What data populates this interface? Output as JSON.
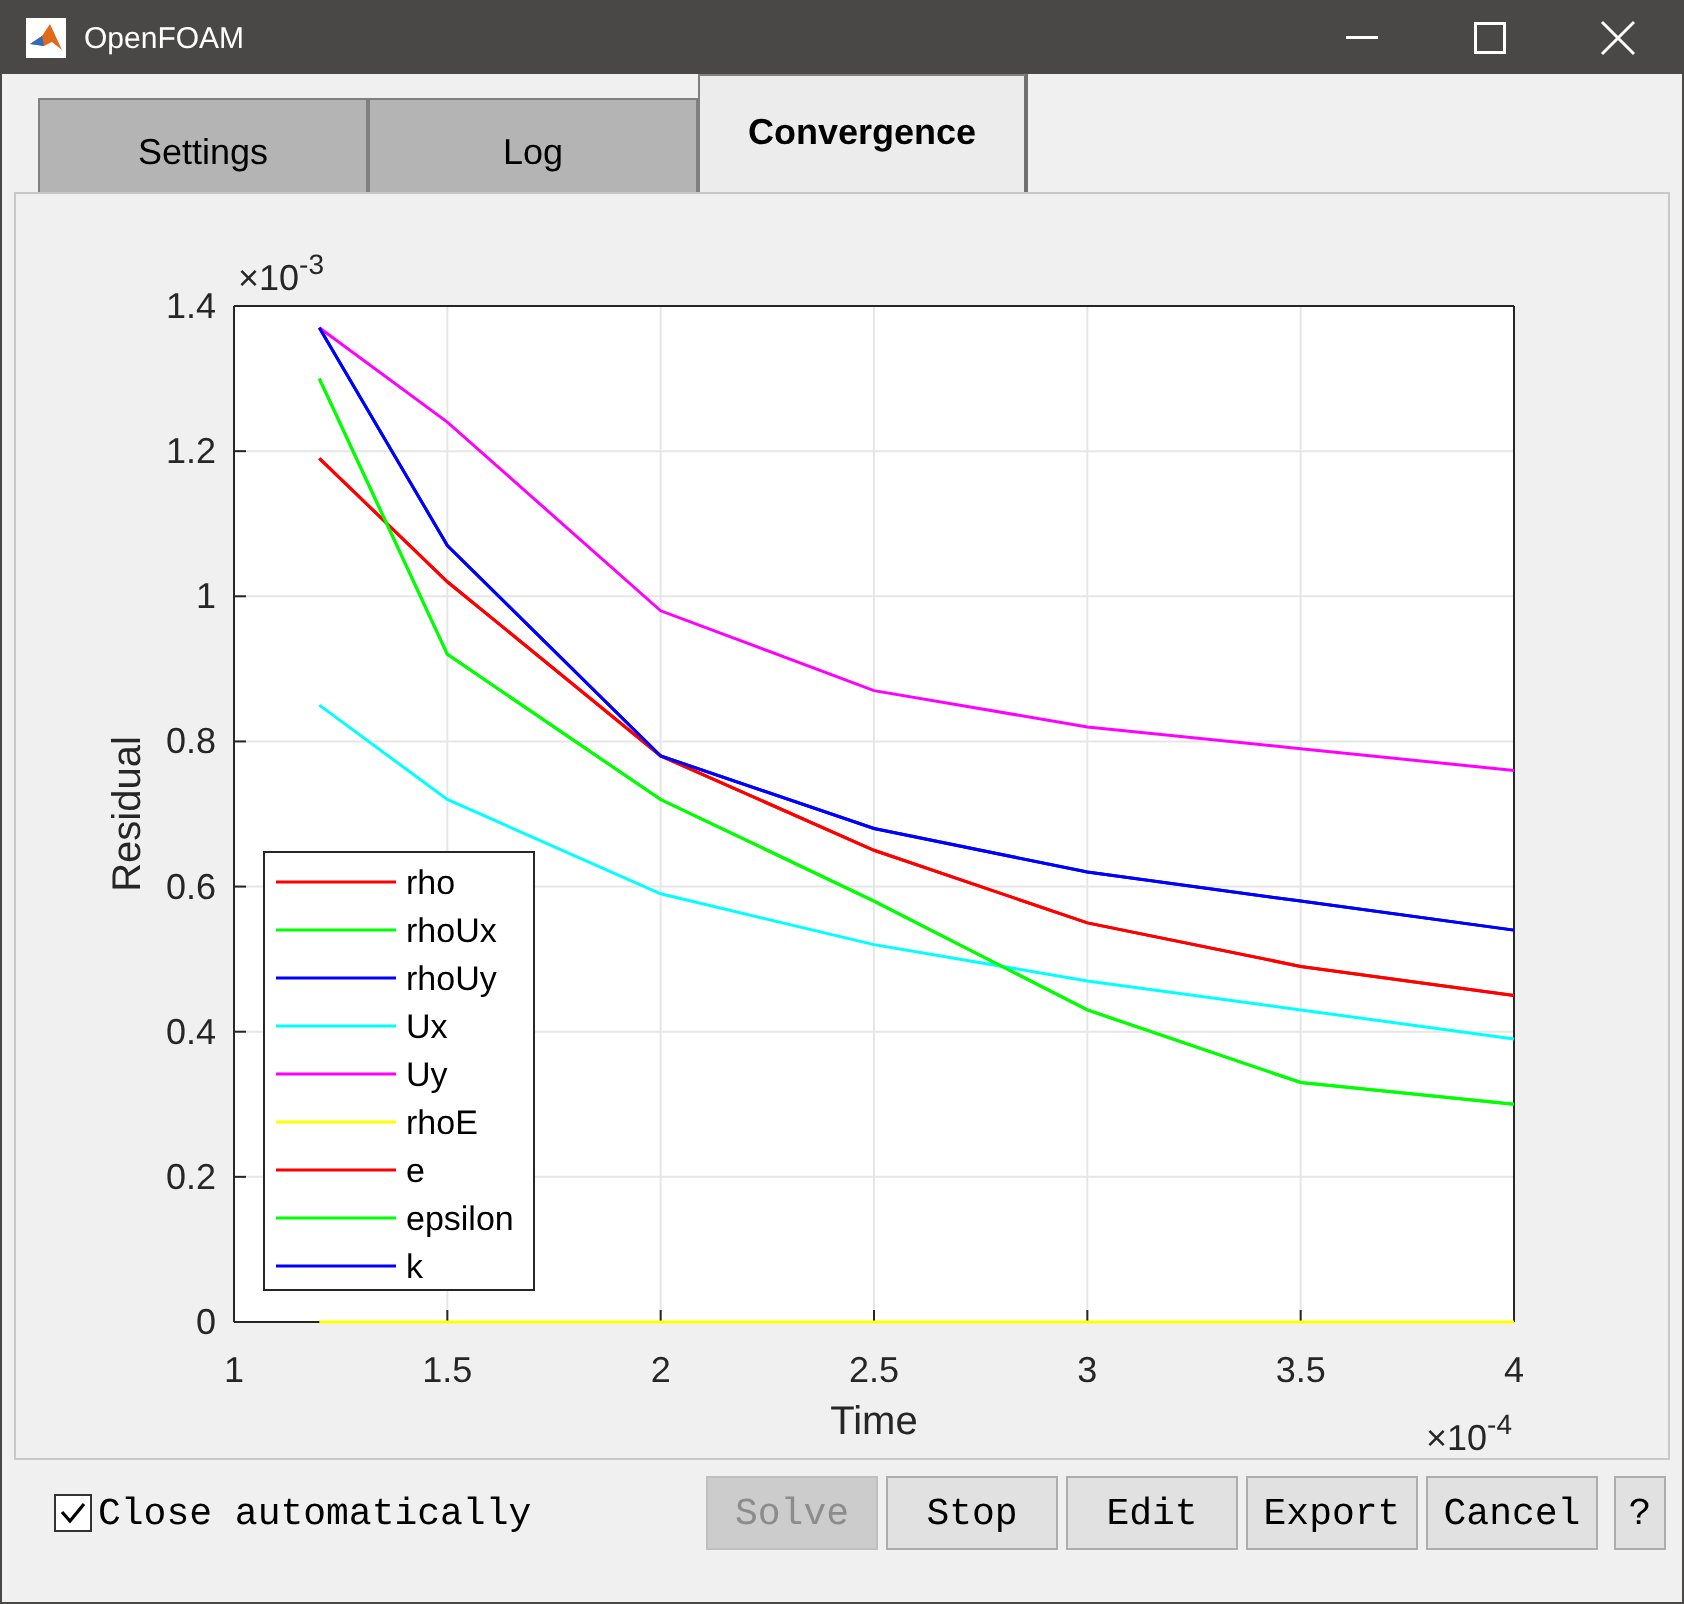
{
  "window": {
    "title": "OpenFOAM"
  },
  "tabs": [
    {
      "label": "Settings",
      "selected": false
    },
    {
      "label": "Log",
      "selected": false
    },
    {
      "label": "Convergence",
      "selected": true
    }
  ],
  "plot": {
    "y_multiplier": {
      "base": "×10",
      "exponent": "-3"
    },
    "x_multiplier": {
      "base": "×10",
      "exponent": "-4"
    },
    "chart_data": {
      "type": "line",
      "grid": true,
      "legend": true,
      "xlabel": "Time",
      "ylabel": "Residual",
      "x": [
        1.2,
        1.5,
        2,
        2.5,
        3,
        3.5,
        4
      ],
      "xlim": [
        1,
        4
      ],
      "ylim": [
        0,
        1.4
      ],
      "xticks": [
        {
          "value": 1,
          "label": "1"
        },
        {
          "value": 1.5,
          "label": "1.5"
        },
        {
          "value": 2,
          "label": "2"
        },
        {
          "value": 2.5,
          "label": "2.5"
        },
        {
          "value": 3,
          "label": "3"
        },
        {
          "value": 3.5,
          "label": "3.5"
        },
        {
          "value": 4,
          "label": "4"
        }
      ],
      "yticks": [
        {
          "value": 0,
          "label": "0"
        },
        {
          "value": 0.2,
          "label": "0.2"
        },
        {
          "value": 0.4,
          "label": "0.4"
        },
        {
          "value": 0.6,
          "label": "0.6"
        },
        {
          "value": 0.8,
          "label": "0.8"
        },
        {
          "value": 1,
          "label": "1"
        },
        {
          "value": 1.2,
          "label": "1.2"
        },
        {
          "value": 1.4,
          "label": "1.4"
        }
      ],
      "series": [
        {
          "name": "rho",
          "color": "#ff0000",
          "values": [
            1.19,
            1.02,
            0.78,
            0.65,
            0.55,
            0.49,
            0.45
          ]
        },
        {
          "name": "rhoUx",
          "color": "#00ff00",
          "values": [
            1.3,
            0.92,
            0.72,
            0.58,
            0.43,
            0.33,
            0.3
          ]
        },
        {
          "name": "rhoUy",
          "color": "#0000ff",
          "values": [
            1.37,
            1.07,
            0.78,
            0.68,
            0.62,
            0.58,
            0.54
          ]
        },
        {
          "name": "Ux",
          "color": "#00ffff",
          "values": [
            0.85,
            0.72,
            0.59,
            0.52,
            0.47,
            0.43,
            0.39
          ]
        },
        {
          "name": "Uy",
          "color": "#ff00ff",
          "values": [
            1.37,
            1.24,
            0.98,
            0.87,
            0.82,
            0.79,
            0.76
          ]
        },
        {
          "name": "rhoE",
          "color": "#ffff00",
          "values": [
            0,
            0,
            0,
            0,
            0,
            0,
            0
          ]
        },
        {
          "name": "e",
          "color": "#ff0000",
          "values": [
            1.19,
            1.02,
            0.78,
            0.65,
            0.55,
            0.49,
            0.45
          ]
        },
        {
          "name": "epsilon",
          "color": "#00ff00",
          "values": [
            1.3,
            0.92,
            0.72,
            0.58,
            0.43,
            0.33,
            0.3
          ]
        },
        {
          "name": "k",
          "color": "#0000ff",
          "values": [
            1.37,
            1.07,
            0.78,
            0.68,
            0.62,
            0.58,
            0.54
          ]
        }
      ]
    }
  },
  "close_automatically": {
    "label": "Close automatically",
    "checked": true
  },
  "buttons": [
    {
      "label": "Solve",
      "disabled": true
    },
    {
      "label": "Stop",
      "disabled": false
    },
    {
      "label": "Edit",
      "disabled": false
    },
    {
      "label": "Export",
      "disabled": false
    },
    {
      "label": "Cancel",
      "disabled": false
    },
    {
      "label": "?",
      "disabled": false
    }
  ]
}
